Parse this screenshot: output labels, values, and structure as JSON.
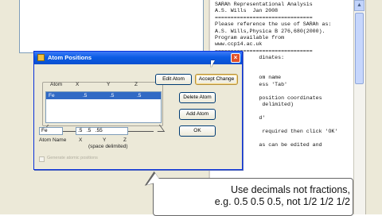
{
  "console": {
    "lines": [
      "SARAh Representational Analysis",
      "A.S. Wills  Jan 2008",
      "===============================",
      "Please reference the use of SARAh as:",
      "A.S. Wills,Physica B 276,680(2000).",
      "Program available from",
      "www.ccp14.ac.uk",
      "===============================",
      "              dinates:",
      "",
      "",
      "              om name",
      "              ess 'Tab'",
      "",
      "              position coordinates",
      "               delimited)",
      "",
      "              d'",
      "",
      "               required then click 'OK'",
      "",
      "              as can be edited and"
    ]
  },
  "dialog": {
    "title": "Atom Positions",
    "close_symbol": "×",
    "headers": {
      "atom": "Atom",
      "x": "X",
      "y": "Y",
      "z": "Z"
    },
    "selected_row": {
      "atom": "Fe",
      "x": ".5",
      "y": ".5",
      "z": ".5"
    },
    "inputs": {
      "atom": "Fe",
      "x": ".5",
      "y": ".5",
      "z": ".55"
    },
    "field_labels": {
      "atom_name": "Atom Name",
      "x": "X",
      "y": "Y",
      "z": "Z",
      "note": "(space delimited)"
    },
    "buttons": {
      "edit_atom": "Edit Atom",
      "accept_change": "Accept Change",
      "delete_atom": "Delete Atom",
      "add_atom": "Add Atom",
      "ok": "OK"
    },
    "checkbox_label": "Generate atomic positions"
  },
  "scrollbar": {
    "up_arrow": "▲"
  },
  "callout": {
    "line1": "Use decimals not fractions,",
    "line2": "e.g. 0.5 0.5 0.5, not 1/2 1/2 1/2"
  }
}
